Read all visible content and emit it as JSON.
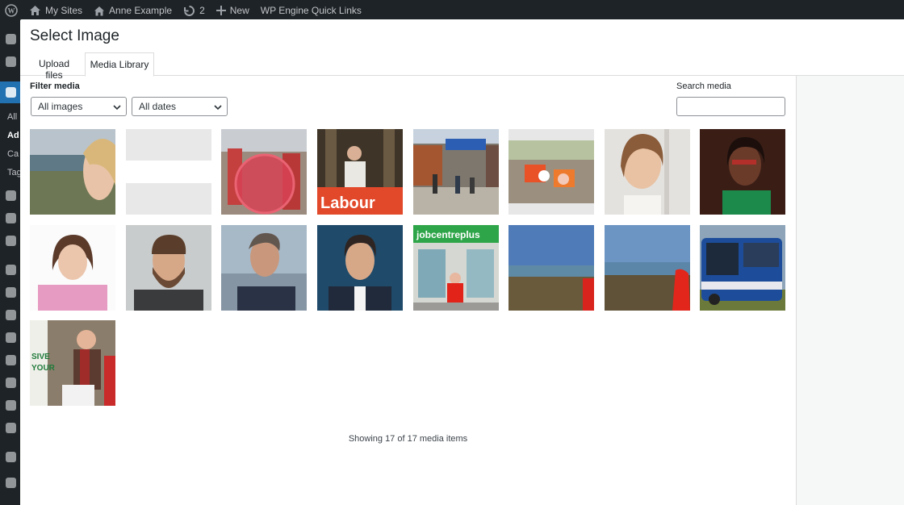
{
  "adminbar": {
    "my_sites": "My Sites",
    "site_name": "Anne Example",
    "updates_count": "2",
    "new_label": "New",
    "quick_links": "WP Engine Quick Links",
    "wp_logo_icon": "wordpress-logo-icon",
    "my_sites_icon": "my-sites-icon",
    "home_icon": "home-icon",
    "updates_icon": "updates-icon",
    "new_icon": "plus-icon"
  },
  "sidebar": {
    "fragments": [
      "All",
      "Ad",
      "Ca",
      "Tag"
    ]
  },
  "modal": {
    "title": "Select Image",
    "tabs": [
      {
        "label": "Upload files",
        "active": false
      },
      {
        "label": "Media Library",
        "active": true
      }
    ],
    "filter_label": "Filter media",
    "type_filter": "All images",
    "date_filter": "All dates",
    "search_label": "Search media",
    "search_value": "",
    "count_text": "Showing 17 of 17 media items"
  },
  "attachments": [
    {
      "alt": "Woman smiling with coastal landscape",
      "icon": "photo-thumbnail"
    },
    {
      "alt": "Blank placeholder image",
      "icon": "placeholder-thumbnail"
    },
    {
      "alt": "Protest crowd with red circle",
      "icon": "photo-thumbnail"
    },
    {
      "alt": "Speaker at Labour podium",
      "icon": "photo-thumbnail"
    },
    {
      "alt": "Street shops with people",
      "icon": "photo-thumbnail"
    },
    {
      "alt": "Campaigners holding placards",
      "icon": "photo-thumbnail"
    },
    {
      "alt": "Woman on phone smiling",
      "icon": "photo-thumbnail"
    },
    {
      "alt": "Woman with glasses in green",
      "icon": "photo-thumbnail"
    },
    {
      "alt": "Woman in pink jacket portrait",
      "icon": "photo-thumbnail"
    },
    {
      "alt": "Bearded man portrait",
      "icon": "photo-thumbnail"
    },
    {
      "alt": "Older man by sea",
      "icon": "photo-thumbnail"
    },
    {
      "alt": "Man in suit portrait",
      "icon": "photo-thumbnail"
    },
    {
      "alt": "Woman outside jobcentre plus",
      "icon": "photo-thumbnail"
    },
    {
      "alt": "Coastal view blue sky",
      "icon": "photo-thumbnail"
    },
    {
      "alt": "Coastal view with person",
      "icon": "photo-thumbnail"
    },
    {
      "alt": "Blue bus",
      "icon": "photo-thumbnail"
    },
    {
      "alt": "Woman at food bank",
      "icon": "photo-thumbnail"
    }
  ],
  "colors": {
    "admin_bg": "#1d2327",
    "accent": "#2271b1",
    "labour_red": "#e4003b"
  }
}
